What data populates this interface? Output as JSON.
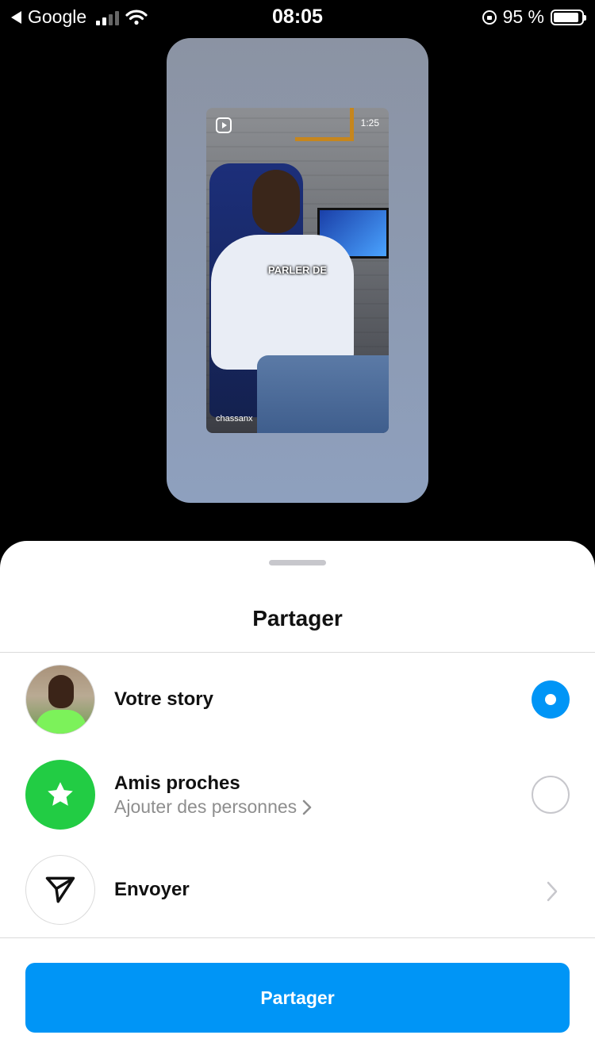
{
  "status_bar": {
    "back_app": "Google",
    "time": "08:05",
    "battery": "95 %"
  },
  "story_preview": {
    "duration": "1:25",
    "caption": "PARLER DE",
    "username": "chassanx"
  },
  "sheet": {
    "title": "Partager",
    "options": [
      {
        "title": "Votre story",
        "selected": true
      },
      {
        "title": "Amis proches",
        "subtitle": "Ajouter des personnes",
        "selected": false
      },
      {
        "title": "Envoyer"
      }
    ],
    "share_button": "Partager"
  },
  "colors": {
    "accent": "#0095f6",
    "close_friends": "#22cc44",
    "sheet_bg": "#ffffff",
    "backdrop": "#000000"
  },
  "icons": [
    "back-arrow-icon",
    "signal-icon",
    "wifi-icon",
    "rotation-lock-icon",
    "battery-icon",
    "reels-icon",
    "star-icon",
    "send-icon",
    "chevron-right-icon"
  ]
}
